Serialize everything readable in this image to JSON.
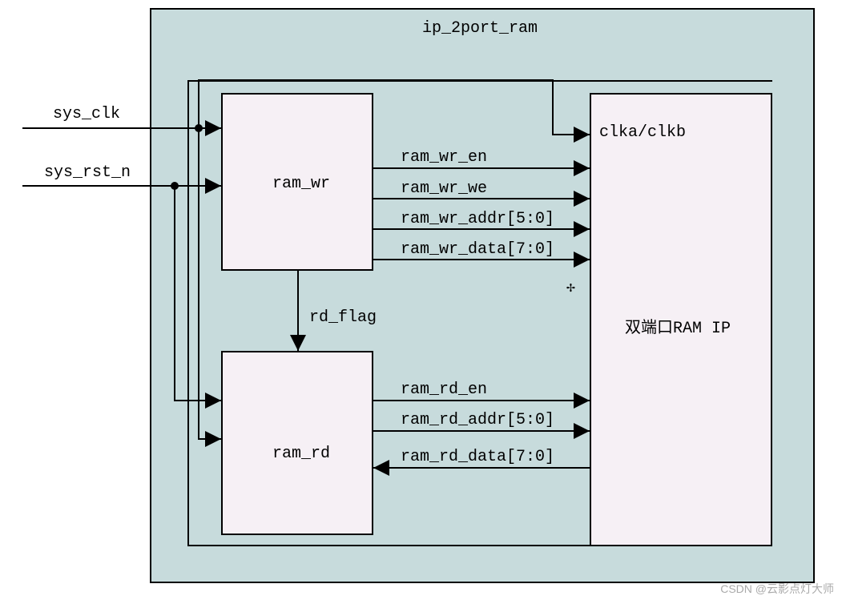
{
  "title": "ip_2port_ram",
  "inputs": {
    "clk": "sys_clk",
    "rst": "sys_rst_n"
  },
  "blocks": {
    "wr": "ram_wr",
    "rd": "ram_rd",
    "ip": "双端口RAM IP"
  },
  "signals": {
    "clk_ip": "clka/clkb",
    "wr_en": "ram_wr_en",
    "wr_we": "ram_wr_we",
    "wr_addr": "ram_wr_addr[5:0]",
    "wr_data": "ram_wr_data[7:0]",
    "rd_flag": "rd_flag",
    "rd_en": "ram_rd_en",
    "rd_addr": "ram_rd_addr[5:0]",
    "rd_data": "ram_rd_data[7:0]"
  },
  "watermark": "CSDN @云影点灯大师",
  "cursor": "⸭"
}
